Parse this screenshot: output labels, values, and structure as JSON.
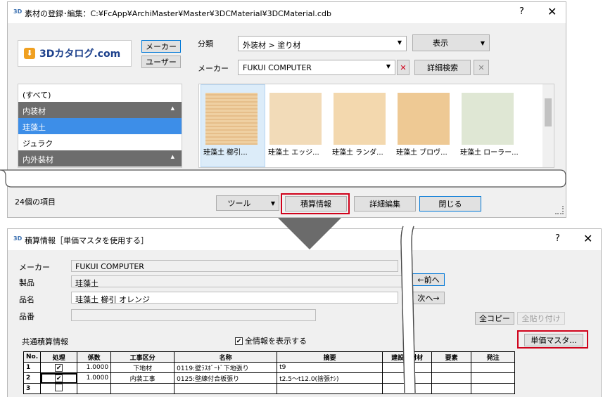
{
  "top": {
    "title": "素材の登録･編集：C:¥FcApp¥ArchiMaster¥Master¥3DCMaterial¥3DCMaterial.cdb",
    "help": "?",
    "close": "✕",
    "logo": "3Dカタログ.com",
    "maker_btn": "メーカー",
    "user_btn": "ユーザー",
    "category_label": "分類",
    "category_value": "外装材 > 塗り材",
    "display_btn": "表示",
    "maker_label": "メーカー",
    "maker_value": "FUKUI COMPUTER",
    "detail_search_btn": "詳細検索",
    "list": [
      "(すべて)",
      "内装材",
      "珪藻土",
      "ジュラク",
      "内外装材"
    ],
    "thumbs": [
      "珪藻土 櫛引...",
      "珪藻土 エッジ...",
      "珪藻土 ランダ...",
      "珪藻土 ブロヴ...",
      "珪藻土 ローラー..."
    ],
    "thumb_colors": [
      "#e8c493",
      "#f2dbb8",
      "#f3d8ae",
      "#eec994",
      "#dfe7d4"
    ],
    "count": "24個の項目",
    "tool_btn": "ツール",
    "sekisan_btn": "積算情報",
    "detail_edit_btn": "詳細編集",
    "close_btn": "閉じる"
  },
  "bottom": {
    "title": "積算情報［単価マスタを使用する］",
    "help": "?",
    "close": "✕",
    "maker_label": "メーカー",
    "maker_value": "FUKUI COMPUTER",
    "product_label": "製品",
    "product_value": "珪藻土",
    "name_label": "品名",
    "name_value": "珪藻土 櫛引 オレンジ",
    "number_label": "品番",
    "number_value": "",
    "prev_btn": "←前へ",
    "next_btn": "次へ→",
    "copy_all_btn": "全コピー",
    "paste_all_btn": "全貼り付け",
    "section_label": "共通積算情報",
    "show_all_label": "全情報を表示する",
    "master_btn": "単価マスタ...",
    "headers": [
      "No.",
      "処理",
      "係数",
      "工事区分",
      "名称",
      "摘要",
      "建設資材材",
      "要素",
      "発注"
    ],
    "rows": [
      {
        "no": "1",
        "coef": "1.0000",
        "kubun": "下地材",
        "name": "0119:壁ﾗｽﾎﾞｰﾄﾞ下地張り",
        "tekiyo": "t9"
      },
      {
        "no": "2",
        "coef": "1.0000",
        "kubun": "内装工事",
        "name": "0125:壁練付合板張り",
        "tekiyo": "t2.5～t12.0(捨張ﾅｼ)"
      },
      {
        "no": "3",
        "coef": "",
        "kubun": "",
        "name": "",
        "tekiyo": ""
      }
    ]
  }
}
